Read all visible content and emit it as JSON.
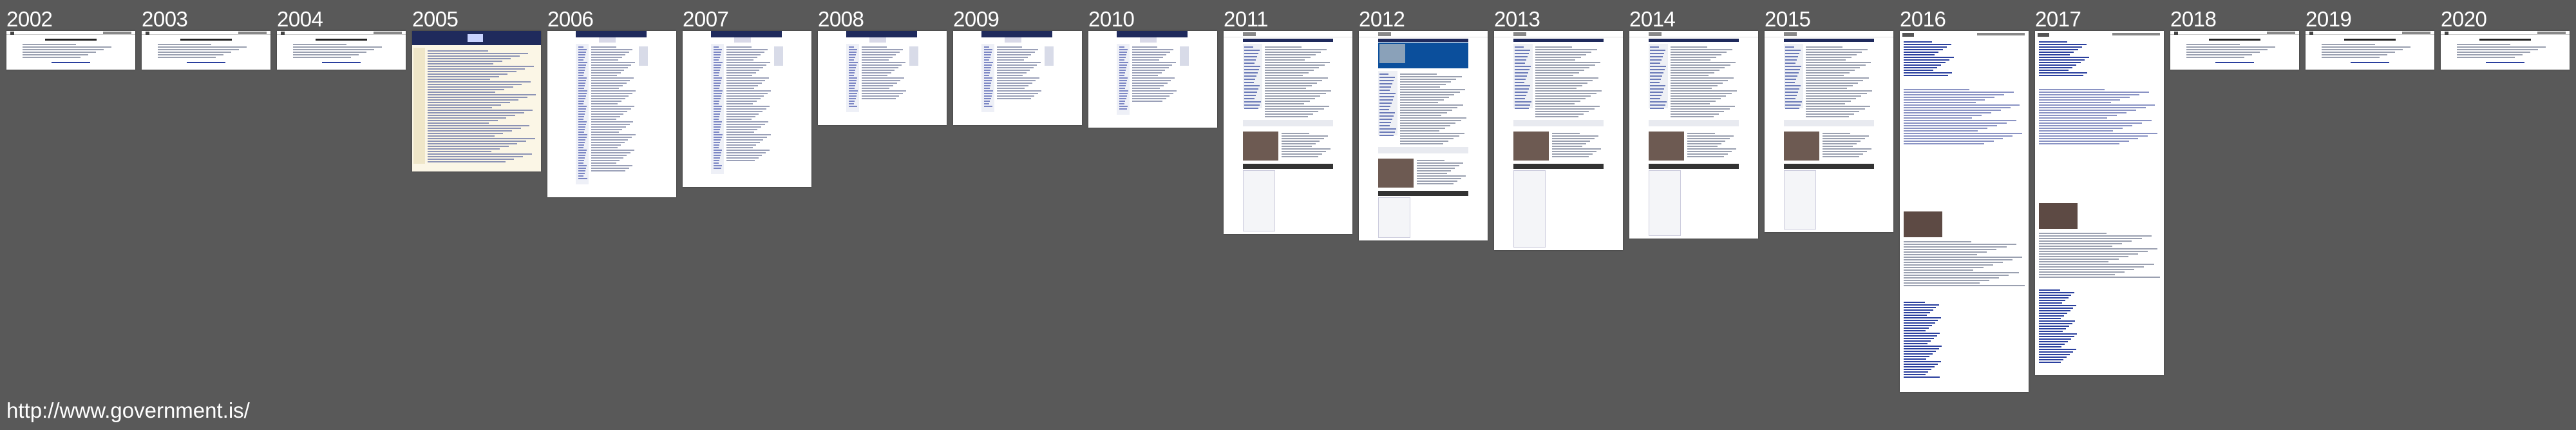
{
  "caption": {
    "url": "http://www.government.is/"
  },
  "years": [
    {
      "year": "2002",
      "style": "splash"
    },
    {
      "year": "2003",
      "style": "splash"
    },
    {
      "year": "2004",
      "style": "splash"
    },
    {
      "year": "2005",
      "style": "cream"
    },
    {
      "year": "2006",
      "style": "classic"
    },
    {
      "year": "2007",
      "style": "classic"
    },
    {
      "year": "2008",
      "style": "classic"
    },
    {
      "year": "2009",
      "style": "classic"
    },
    {
      "year": "2010",
      "style": "classic"
    },
    {
      "year": "2011",
      "style": "modern"
    },
    {
      "year": "2012",
      "style": "modern-blue"
    },
    {
      "year": "2013",
      "style": "modern"
    },
    {
      "year": "2014",
      "style": "modern"
    },
    {
      "year": "2015",
      "style": "modern"
    },
    {
      "year": "2016",
      "style": "plain"
    },
    {
      "year": "2017",
      "style": "plain"
    },
    {
      "year": "2018",
      "style": "splash"
    },
    {
      "year": "2019",
      "style": "splash"
    },
    {
      "year": "2020",
      "style": "splash"
    }
  ],
  "colors": {
    "background": "#595959",
    "navy": "#1f2a5c",
    "cream": "#fbf6e6",
    "link": "#2a3f9e"
  }
}
